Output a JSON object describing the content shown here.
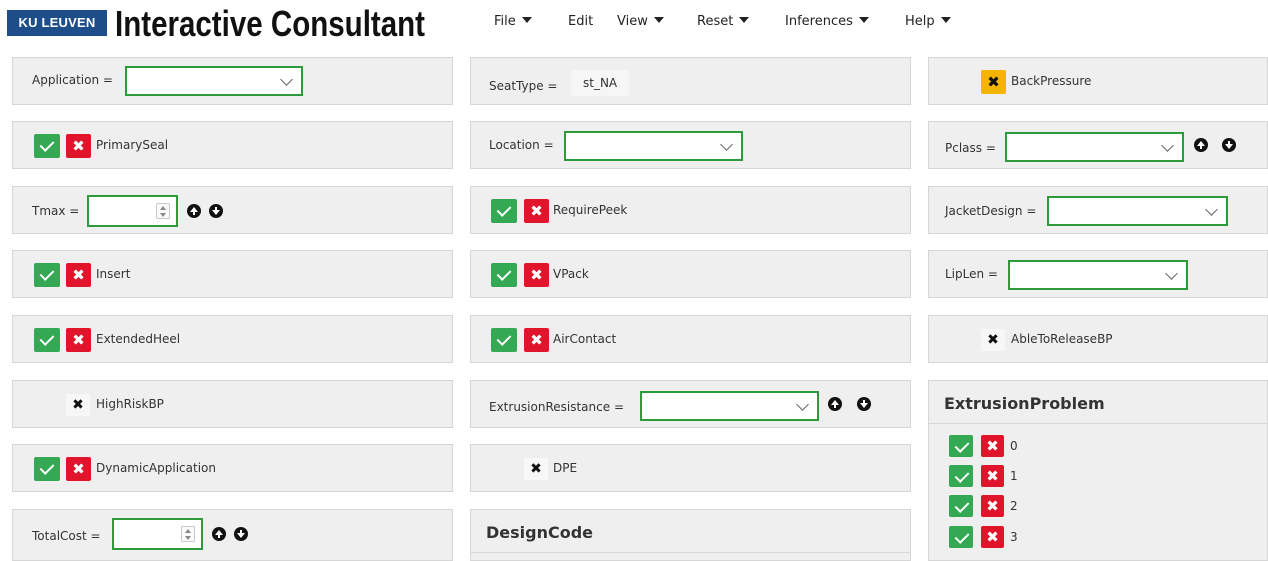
{
  "header": {
    "logo": "KU LEUVEN",
    "title": "Interactive Consultant",
    "menus": [
      {
        "label": "File",
        "caret": true
      },
      {
        "label": "Edit",
        "caret": false
      },
      {
        "label": "View",
        "caret": true
      },
      {
        "label": "Reset",
        "caret": true
      },
      {
        "label": "Inferences",
        "caret": true
      },
      {
        "label": "Help",
        "caret": true
      }
    ]
  },
  "col1": {
    "application": {
      "label": "Application =",
      "value": ""
    },
    "primaryseal": {
      "label": "PrimarySeal"
    },
    "tmax": {
      "label": "Tmax =",
      "value": ""
    },
    "insert": {
      "label": "Insert"
    },
    "extendedheel": {
      "label": "ExtendedHeel"
    },
    "highriskbp": {
      "label": "HighRiskBP",
      "x": "✖"
    },
    "dynamicapplication": {
      "label": "DynamicApplication"
    },
    "totalcost": {
      "label": "TotalCost =",
      "value": ""
    }
  },
  "col2": {
    "seattype": {
      "label": "SeatType =",
      "value": "st_NA"
    },
    "location": {
      "label": "Location =",
      "value": ""
    },
    "requirepeek": {
      "label": "RequirePeek"
    },
    "vpack": {
      "label": "VPack"
    },
    "aircontact": {
      "label": "AirContact"
    },
    "extrusionresistance": {
      "label": "ExtrusionResistance =",
      "value": ""
    },
    "dpe": {
      "label": "DPE",
      "x": "✖"
    },
    "designcode": {
      "heading": "DesignCode"
    }
  },
  "col3": {
    "backpressure": {
      "label": "BackPressure",
      "x": "✖"
    },
    "pclass": {
      "label": "Pclass =",
      "value": ""
    },
    "jacketdesign": {
      "label": "JacketDesign =",
      "value": ""
    },
    "liplen": {
      "label": "LipLen =",
      "value": ""
    },
    "abletoreleasebp": {
      "label": "AbleToReleaseBP",
      "x": "✖"
    },
    "extrusionproblem": {
      "heading": "ExtrusionProblem",
      "options": [
        "0",
        "1",
        "2",
        "3"
      ]
    }
  },
  "icons": {
    "reject": "✖"
  },
  "colors": {
    "accept": "#34a853",
    "reject": "#e0152b",
    "warning": "#f4b400",
    "border": "#2e9a3a",
    "logo": "#1d4e89"
  }
}
